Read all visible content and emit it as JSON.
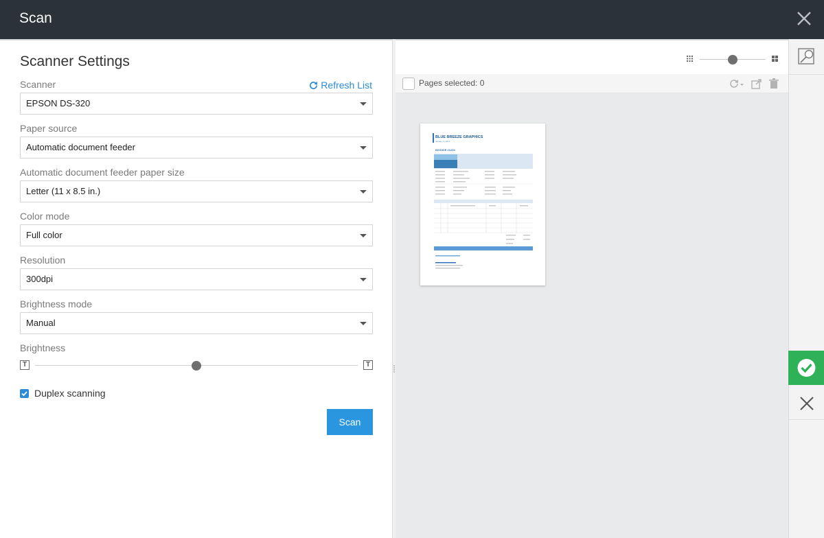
{
  "window": {
    "title": "Scan"
  },
  "settings": {
    "heading": "Scanner Settings",
    "refresh_label": "Refresh List",
    "scanner": {
      "label": "Scanner",
      "value": "EPSON DS-320"
    },
    "paper_source": {
      "label": "Paper source",
      "value": "Automatic document feeder"
    },
    "paper_size": {
      "label": "Automatic document feeder paper size",
      "value": "Letter (11 x 8.5 in.)"
    },
    "color_mode": {
      "label": "Color mode",
      "value": "Full color"
    },
    "resolution": {
      "label": "Resolution",
      "value": "300dpi"
    },
    "brightness_mode": {
      "label": "Brightness mode",
      "value": "Manual"
    },
    "brightness": {
      "label": "Brightness",
      "level": 0.5
    },
    "duplex": {
      "label": "Duplex scanning",
      "checked": true
    },
    "scan_button": "Scan"
  },
  "preview": {
    "zoom_level": 0.5,
    "pages_selected_label": "Pages selected: 0"
  },
  "colors": {
    "titlebar": "#2b3338",
    "accent": "#2b96e0",
    "confirm": "#2fb157"
  },
  "icons": [
    "close-icon",
    "refresh-icon",
    "chevron-down-icon",
    "brightness-low-icon",
    "brightness-high-icon",
    "grid-small-icon",
    "grid-large-icon",
    "rotate-icon",
    "extract-icon",
    "trash-icon",
    "zoom-preview-icon",
    "check-icon",
    "cancel-icon"
  ]
}
